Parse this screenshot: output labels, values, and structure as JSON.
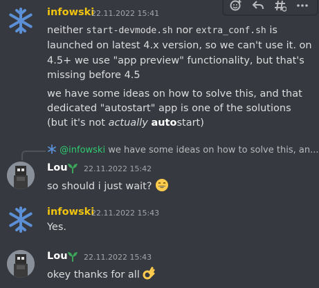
{
  "toolbar": {
    "icons": [
      "add-reaction-icon",
      "reply-icon",
      "thread-icon",
      "more-icon"
    ]
  },
  "messages": [
    {
      "username": "infowski",
      "timestamp": "22.11.2022 15:41",
      "lines": [
        {
          "pre1": "neither ",
          "code1": "start-devmode.sh",
          "mid": " nor ",
          "code2": "extra_conf.sh",
          "post": " is"
        },
        {
          "text": "launched on latest 4.x version, so we can't use it. on"
        },
        {
          "text": "4.5+ we use \"app preview\" functionality, but that's"
        },
        {
          "text": "missing before 4.5"
        }
      ],
      "lines2": [
        {
          "text": "we have some ideas on how to solve this, and that"
        },
        {
          "text": "dedicated \"autostart\" app is one of the solutions"
        },
        {
          "pre": "(but it's not ",
          "italic": "actually",
          "space": " ",
          "bold": "auto",
          "post": "start)"
        }
      ]
    },
    {
      "reply": {
        "mention": "@infowski",
        "preview": " we have some ideas on how to solve this, an..."
      },
      "username": "Lou",
      "timestamp": "22.11.2022 15:42",
      "text": "so should i just wait?",
      "emoji": "grinning-face"
    },
    {
      "username": "infowski",
      "timestamp": "22.11.2022 15:43",
      "text": "Yes."
    },
    {
      "username": "Lou",
      "timestamp": "22.11.2022 15:43",
      "text": "okey thanks for all",
      "emoji": "ok-hand"
    }
  ],
  "colors": {
    "background": "#36393f",
    "infowski_name": "#f1c40f",
    "lou_name": "#ffffff",
    "text": "#dcddde",
    "muted": "#a3a6aa",
    "mention": "#2ecc71"
  }
}
